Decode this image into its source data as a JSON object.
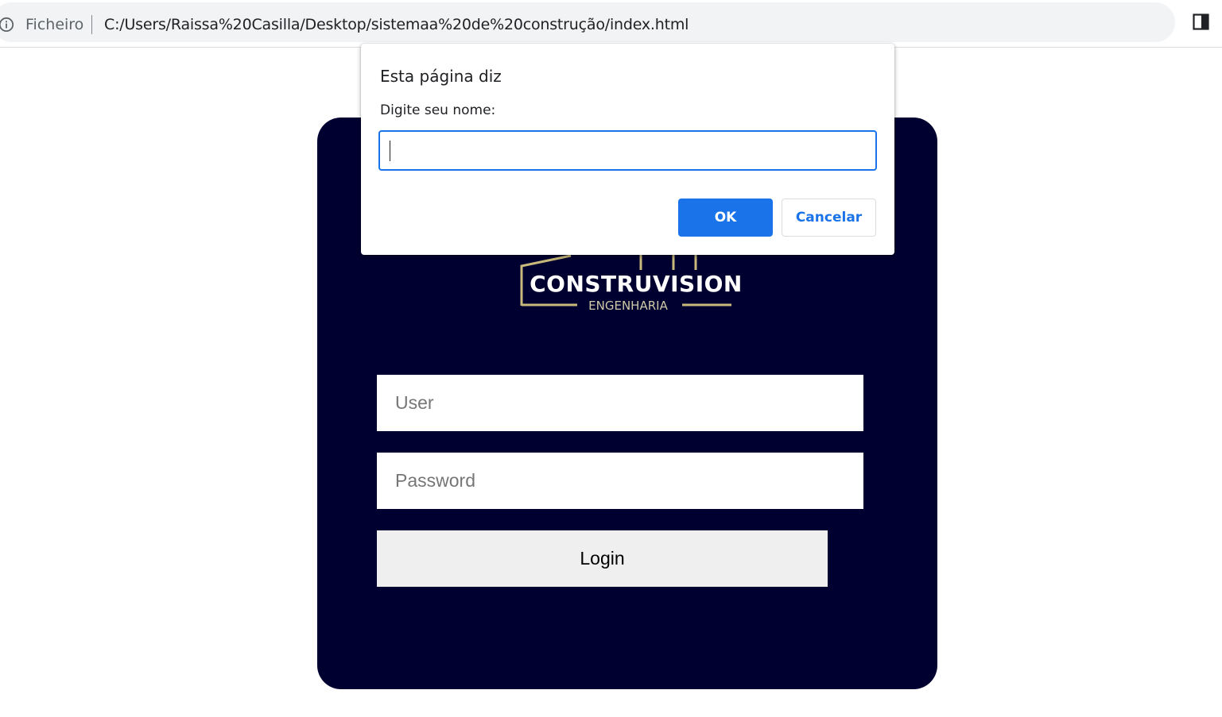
{
  "browser": {
    "scheme_label": "Ficheiro",
    "url": "C:/Users/Raissa%20Casilla/Desktop/sistemaa%20de%20construção/index.html",
    "info_icon": "info-icon",
    "side_panel_icon": "side-panel-icon"
  },
  "logo": {
    "title": "CONSTRUVISION",
    "subtitle": "ENGENHARIA",
    "color_gold": "#c9b97a"
  },
  "login_form": {
    "user_placeholder": "User",
    "password_placeholder": "Password",
    "login_label": "Login"
  },
  "dialog": {
    "title": "Esta página diz",
    "message": "Digite seu nome:",
    "input_value": "",
    "ok_label": "OK",
    "cancel_label": "Cancelar"
  },
  "colors": {
    "card_background": "#000030",
    "accent": "#1a73e8"
  }
}
